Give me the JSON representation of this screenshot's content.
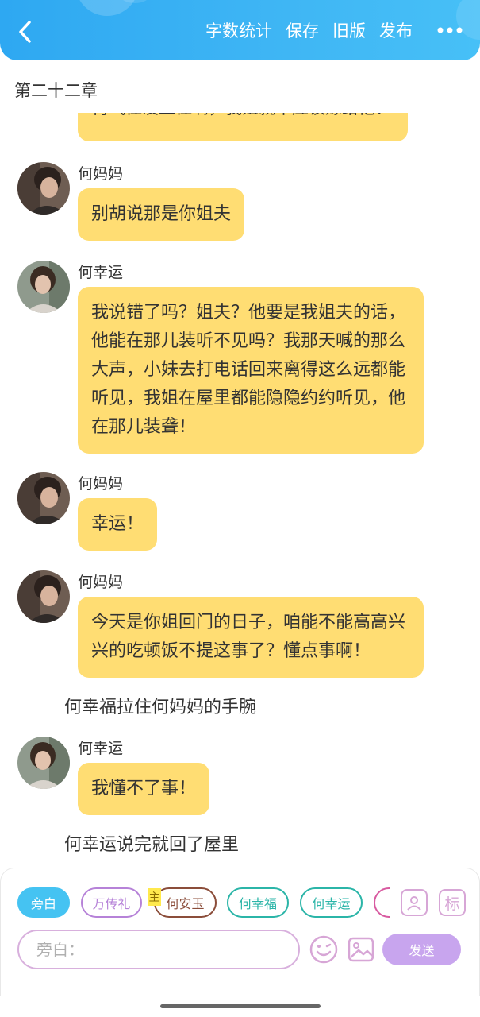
{
  "header": {
    "back_icon": "chevron-left-icon",
    "actions": [
      "字数统计",
      "保存",
      "旧版",
      "发布"
    ],
    "more_icon": "more-dots-icon",
    "background": "#3ab2f4"
  },
  "chapter_title": "第二十二章",
  "chat": {
    "cut_off_text": "再气住没血住啊，我姐就不应该嫁给他！",
    "bubble_color": "#ffdd73",
    "messages": [
      {
        "speaker": "何妈妈",
        "text": "别胡说那是你姐夫"
      },
      {
        "speaker": "何幸运",
        "text": "我说错了吗？姐夫？他要是我姐夫的话，他能在那儿装听不见吗？我那天喊的那么大声，小妹去打电话回来离得这么远都能听见，我姐在屋里都能隐隐约约听见，他在那儿装聋！"
      },
      {
        "speaker": "何妈妈",
        "text": "幸运！"
      },
      {
        "speaker": "何妈妈",
        "text": "今天是你姐回门的日子，咱能不能高高兴兴的吃顿饭不提这事了？懂点事啊！"
      },
      {
        "narration": "何幸福拉住何妈妈的手腕"
      },
      {
        "speaker": "何幸运",
        "text": "我懂不了事！"
      },
      {
        "narration": "何幸运说完就回了屋里"
      }
    ]
  },
  "roles": [
    {
      "label": "旁白",
      "color": "#45c3f2",
      "selected": true
    },
    {
      "label": "万传礼",
      "color": "#b682d8",
      "selected": false
    },
    {
      "label": "何安玉",
      "color": "#8b4d3a",
      "selected": false,
      "badge": "主"
    },
    {
      "label": "何幸福",
      "color": "#2bb5a8",
      "selected": false
    },
    {
      "label": "何幸运",
      "color": "#2bb5a8",
      "selected": false
    },
    {
      "label": "",
      "color": "#d85aa0",
      "selected": false
    }
  ],
  "role_tools": {
    "character_icon": "person-card-icon",
    "tag_label": "标"
  },
  "composer": {
    "placeholder": "旁白：",
    "value": "",
    "emoji_icon": "emoji-icon",
    "image_icon": "image-icon",
    "send_label": "发送"
  }
}
